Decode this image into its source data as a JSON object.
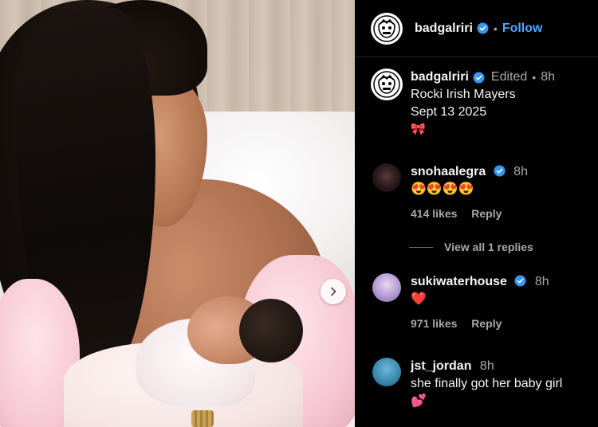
{
  "header": {
    "username": "badgalriri",
    "separator": "•",
    "follow_label": "Follow"
  },
  "caption": {
    "username": "badgalriri",
    "edited_label": "Edited",
    "separator": "•",
    "time": "8h",
    "line1": "Rocki Irish Mayers",
    "line2": "Sept 13 2025",
    "emoji": "🎀"
  },
  "comments": [
    {
      "username": "snohaalegra",
      "verified": true,
      "time": "8h",
      "text": "😍😍😍😍",
      "likes": "414 likes",
      "reply_label": "Reply"
    },
    {
      "username": "sukiwaterhouse",
      "verified": true,
      "time": "8h",
      "text": "❤️",
      "likes": "971 likes",
      "reply_label": "Reply"
    },
    {
      "username": "jst_jordan",
      "verified": false,
      "time": "8h",
      "text": "she finally got her baby girl",
      "text2": "💕"
    }
  ],
  "view_replies_label": "View all 1 replies",
  "colors": {
    "accent": "#4ea6ff",
    "background": "#000000",
    "muted": "#a8a8a8",
    "verified": "#3797f0"
  },
  "icons": {
    "verified": "verified-badge-icon",
    "next": "chevron-right-icon"
  }
}
